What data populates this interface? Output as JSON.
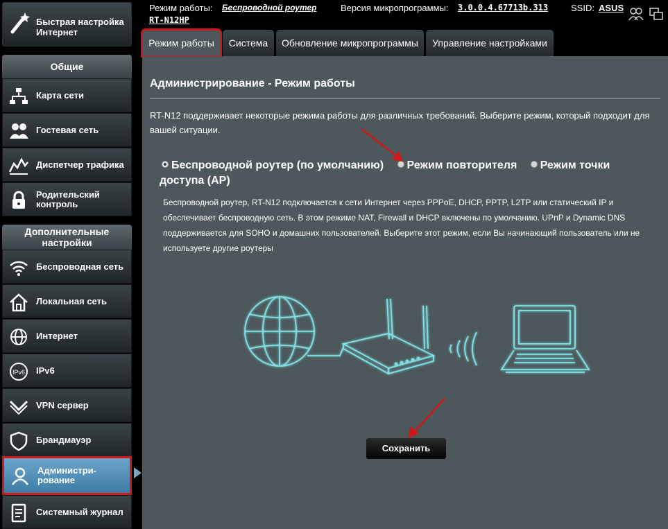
{
  "sidebar": {
    "quick_setup": "Быстрая настройка Интернет",
    "general_header": "Общие",
    "general_items": [
      {
        "label": "Карта сети",
        "icon": "network-map-icon"
      },
      {
        "label": "Гостевая сеть",
        "icon": "guest-network-icon"
      },
      {
        "label": "Диспетчер трафика",
        "icon": "traffic-manager-icon"
      },
      {
        "label": "Родительский контроль",
        "icon": "parental-control-icon"
      }
    ],
    "advanced_header": "Дополнительные настройки",
    "advanced_items": [
      {
        "label": "Беспроводная сеть",
        "icon": "wireless-icon"
      },
      {
        "label": "Локальная сеть",
        "icon": "lan-icon"
      },
      {
        "label": "Интернет",
        "icon": "internet-globe-icon"
      },
      {
        "label": "IPv6",
        "icon": "ipv6-icon"
      },
      {
        "label": "VPN сервер",
        "icon": "vpn-icon"
      },
      {
        "label": "Брандмауэр",
        "icon": "firewall-icon"
      },
      {
        "label": "Администри-рование",
        "icon": "administration-icon"
      },
      {
        "label": "Системный журнал",
        "icon": "system-log-icon"
      }
    ]
  },
  "topbar": {
    "mode_label": "Режим работы:",
    "mode_value": "Беспроводной роутер",
    "firmware_label": "Версия микропрограммы:",
    "firmware_value": "3.0.0.4.67713b.313",
    "ssid_label": "SSID:",
    "ssid_value": "ASUS",
    "model": "RT-N12HP"
  },
  "tabs": [
    "Режим работы",
    "Система",
    "Обновление микропрограммы",
    "Управление настройками"
  ],
  "main": {
    "title": "Администрирование - Режим работы",
    "intro": "RT-N12 поддерживает некоторые режима работы для различных требований. Выберите режим, который подходит для вашей ситуации.",
    "modes": [
      {
        "label": "Беспроводной роутер (по умолчанию)",
        "selected": true
      },
      {
        "label": "Режим повторителя",
        "selected": false
      },
      {
        "label": "Режим точки доступа (AP)",
        "selected": false
      }
    ],
    "description": "Беспроводной роутер, RT-N12 подключается к сети Интернет через PPPoE, DHCP, PPTP, L2TP или статический IP и обеспечивает беспроводную сеть. В этом режиме NAT, Firewall и DHCP включены по умолчанию. UPnP и Dynamic DNS поддерживается для SOHO и домашних пользователей. Выберите этот режим, если Вы начинающий пользователь или не используете другие роутеры",
    "save": "Сохранить"
  },
  "colors": {
    "panel_bg": "#4d585c",
    "highlight_red": "#d01818",
    "illustration_cyan": "#7fe3e6",
    "active_nav": "#4f8db5"
  }
}
